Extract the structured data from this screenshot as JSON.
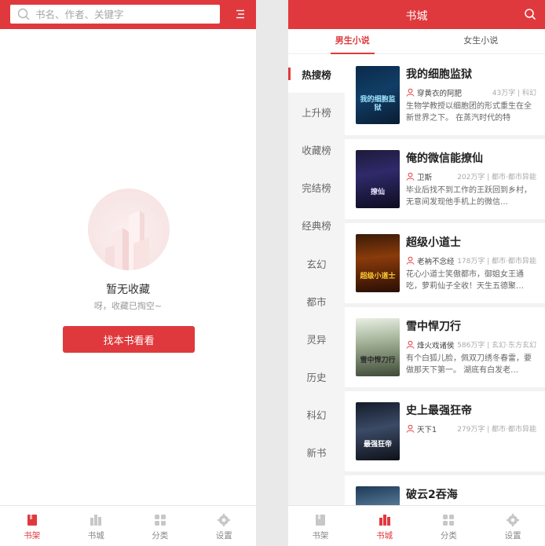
{
  "left": {
    "search": {
      "placeholder": "书名、作者、关键字"
    },
    "empty": {
      "title": "暂无收藏",
      "subtitle": "呀，收藏已掏空~",
      "button": "找本书看看"
    },
    "tabbar": [
      {
        "label": "书架",
        "icon": "bookshelf-icon",
        "active": true
      },
      {
        "label": "书城",
        "icon": "bookstore-icon",
        "active": false
      },
      {
        "label": "分类",
        "icon": "category-icon",
        "active": false
      },
      {
        "label": "设置",
        "icon": "settings-icon",
        "active": false
      }
    ]
  },
  "right": {
    "title": "书城",
    "gender_tabs": [
      {
        "label": "男生小说",
        "active": true
      },
      {
        "label": "女生小说",
        "active": false
      }
    ],
    "sidebar": [
      "热搜榜",
      "上升榜",
      "收藏榜",
      "完结榜",
      "经典榜",
      "玄幻",
      "都市",
      "灵异",
      "历史",
      "科幻",
      "新书"
    ],
    "sidebar_active": 0,
    "books": [
      {
        "title": "我的细胞监狱",
        "author": "穿黄衣的阿肥",
        "info": "43万字 | 科幻",
        "desc": "生物学教授以细胞团的形式重生在全新世界之下。 在蒸汽时代的特",
        "cover_text": "我的细胞监狱"
      },
      {
        "title": "俺的微信能撩仙",
        "author": "卫斯",
        "info": "202万字 | 都市·都市异能",
        "desc": "毕业后找不到工作的王跃回到乡村，无意间发现他手机上的微信…",
        "cover_text": "撩仙"
      },
      {
        "title": "超级小道士",
        "author": "老衲不念经",
        "info": "178万字 | 都市·都市异能",
        "desc": "花心小道士笑傲都市，御姐女王通吃，萝莉仙子全收！天生五德聚…",
        "cover_text": "超级小道士"
      },
      {
        "title": "雪中悍刀行",
        "author": "烽火戏诸侯",
        "info": "586万字 | 玄幻·东方玄幻",
        "desc": "有个白狐儿脸，佩双刀绣冬春雷，要做那天下第一。 湖底有白发老…",
        "cover_text": "雪中悍刀行"
      },
      {
        "title": "史上最强狂帝",
        "author": "天下1",
        "info": "279万字 | 都市·都市异能",
        "desc": "",
        "cover_text": "最强狂帝"
      },
      {
        "title": "破云2吞海",
        "author": "",
        "info": "",
        "desc": "",
        "cover_text": ""
      }
    ],
    "tabbar": [
      {
        "label": "书架",
        "icon": "bookshelf-icon",
        "active": false
      },
      {
        "label": "书城",
        "icon": "bookstore-icon",
        "active": true
      },
      {
        "label": "分类",
        "icon": "category-icon",
        "active": false
      },
      {
        "label": "设置",
        "icon": "settings-icon",
        "active": false
      }
    ]
  },
  "colors": {
    "accent": "#e0393d",
    "sidebar_bg": "#f4f4f4",
    "muted": "#999999"
  }
}
